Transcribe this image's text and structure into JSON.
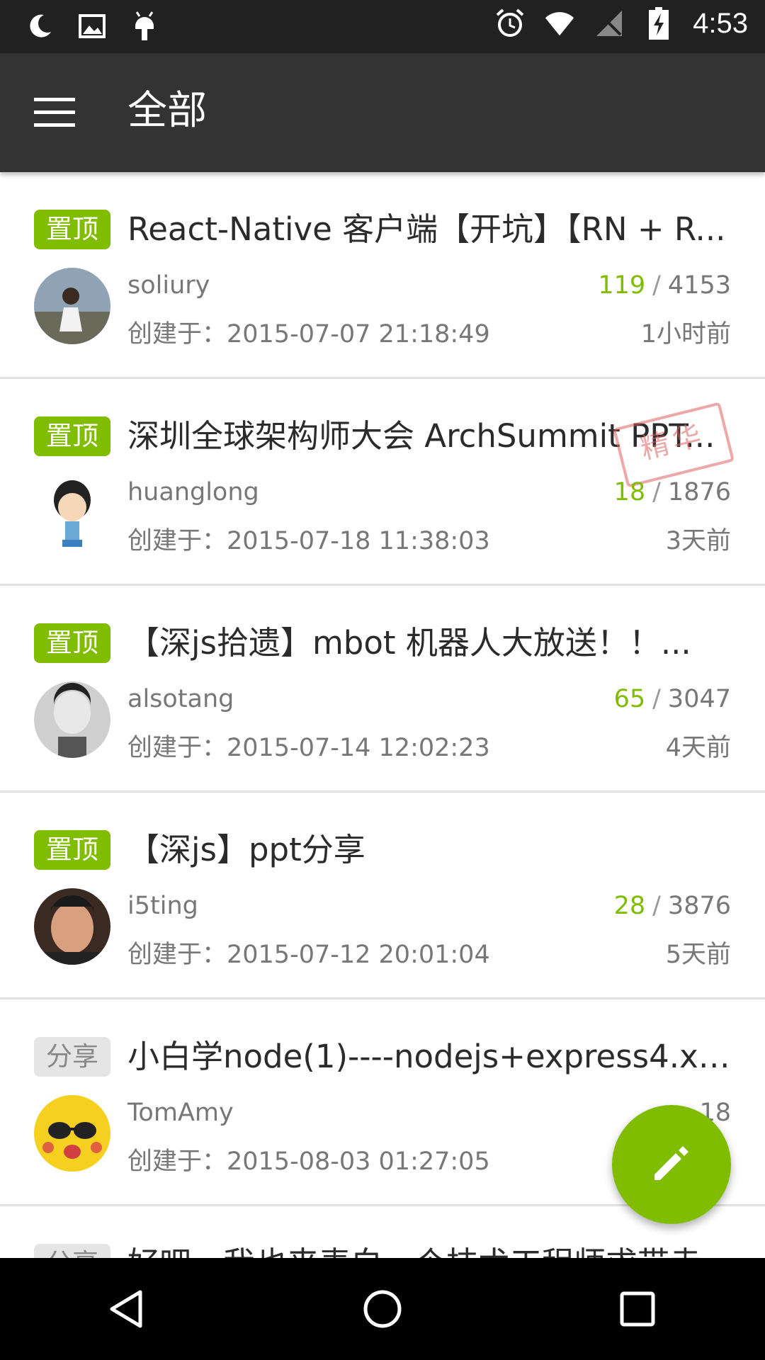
{
  "status_bar": {
    "time": "4:53",
    "left_icons": [
      "moon-icon",
      "image-icon",
      "android-icon"
    ],
    "right_icons": [
      "alarm-icon",
      "wifi-icon",
      "no-sim-icon",
      "battery-charging-icon"
    ]
  },
  "app_bar": {
    "title": "全部",
    "menu_icon": "hamburger-menu-icon"
  },
  "colors": {
    "accent": "#80bd01",
    "appbar": "#333333",
    "statusbar": "#212121"
  },
  "topics": [
    {
      "tag": "置顶",
      "title": "React-Native 客户端【开坑】【RN + R...",
      "author": "soliury",
      "reply_count": "119",
      "visit_count": "4153",
      "created": "创建于：2015-07-07 21:18:49",
      "last_reply": "1小时前"
    },
    {
      "tag": "置顶",
      "title": "深圳全球架构师大会 ArchSummit PPT...",
      "author": "huanglong",
      "reply_count": "18",
      "visit_count": "1876",
      "created": "创建于：2015-07-18 11:38:03",
      "last_reply": "3天前",
      "badge": "精华"
    },
    {
      "tag": "置顶",
      "title": "【深js拾遗】mbot 机器人大放送！！...",
      "author": "alsotang",
      "reply_count": "65",
      "visit_count": "3047",
      "created": "创建于：2015-07-14 12:02:23",
      "last_reply": "4天前"
    },
    {
      "tag": "置顶",
      "title": "【深js】ppt分享",
      "author": "i5ting",
      "reply_count": "28",
      "visit_count": "3876",
      "created": "创建于：2015-07-12 20:01:04",
      "last_reply": "5天前"
    },
    {
      "tag": "分享",
      "title": "小白学node(1)----nodejs+express4.x+r...",
      "author": "TomAmy",
      "reply_count": "",
      "visit_count": "18",
      "created": "创建于：2015-08-03 01:27:05",
      "last_reply": ""
    },
    {
      "tag": "分享",
      "title": "好吧，我也来表白一个技术工程师求带走",
      "author": "",
      "reply_count": "",
      "visit_count": "",
      "created": "",
      "last_reply": ""
    }
  ],
  "fab": {
    "icon": "pencil-icon"
  },
  "nav_bar": {
    "icons": [
      "back-triangle-icon",
      "home-circle-icon",
      "recents-square-icon"
    ]
  }
}
